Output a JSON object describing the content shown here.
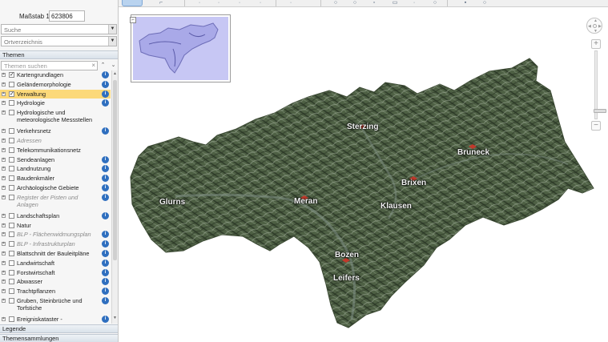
{
  "scale": {
    "label": "Maßstab 1:",
    "value": "623806"
  },
  "search": {
    "placeholder": "Suche"
  },
  "placeindex": {
    "placeholder": "Ortverzeichnis"
  },
  "themes": {
    "header": "Themen",
    "filter_placeholder": "Themen suchen",
    "items": [
      {
        "label": "Kartengrundlagen",
        "checked": true,
        "info": true
      },
      {
        "label": "Geländemorphologie",
        "checked": false,
        "info": true
      },
      {
        "label": "Verwaltung",
        "checked": true,
        "info": true,
        "selected": true
      },
      {
        "label": "Hydrologie",
        "checked": false,
        "info": true
      },
      {
        "label": "Hydrologische und meteorologische Messstellen",
        "checked": false,
        "info": false
      },
      {
        "label": "Verkehrsnetz",
        "checked": false,
        "info": true
      },
      {
        "label": "Adressen",
        "checked": false,
        "info": false,
        "disabled": true
      },
      {
        "label": "Telekommunikationsnetz",
        "checked": false,
        "info": false
      },
      {
        "label": "Sendeanlagen",
        "checked": false,
        "info": true
      },
      {
        "label": "Landnutzung",
        "checked": false,
        "info": true
      },
      {
        "label": "Baudenkmäler",
        "checked": false,
        "info": true
      },
      {
        "label": "Archäologische Gebiete",
        "checked": false,
        "info": true
      },
      {
        "label": "Register der Pisten und Anlagen",
        "checked": false,
        "info": true,
        "disabled": true
      },
      {
        "label": "Landschaftsplan",
        "checked": false,
        "info": true
      },
      {
        "label": "Natur",
        "checked": false,
        "info": false
      },
      {
        "label": "BLP - Flächenwidmungsplan",
        "checked": false,
        "info": true,
        "disabled": true
      },
      {
        "label": "BLP - Infrastrukturplan",
        "checked": false,
        "info": true,
        "disabled": true
      },
      {
        "label": "Blattschnitt der Bauleitpläne",
        "checked": false,
        "info": true
      },
      {
        "label": "Landwirtschaft",
        "checked": false,
        "info": true
      },
      {
        "label": "Forstwirtschaft",
        "checked": false,
        "info": true
      },
      {
        "label": "Abwasser",
        "checked": false,
        "info": true
      },
      {
        "label": "Trachtpflanzen",
        "checked": false,
        "info": true
      },
      {
        "label": "Gruben, Steinbrüche und Torfstiche",
        "checked": false,
        "info": true
      },
      {
        "label": "Ereigniskataster - Naturgefahrenkataster",
        "checked": false,
        "info": true
      }
    ]
  },
  "legend_header": "Legende",
  "collections_header": "Themensammlungen",
  "map": {
    "cities": [
      {
        "name": "Sterzing"
      },
      {
        "name": "Bruneck"
      },
      {
        "name": "Brixen"
      },
      {
        "name": "Glurns"
      },
      {
        "name": "Meran"
      },
      {
        "name": "Klausen"
      },
      {
        "name": "Bozen"
      },
      {
        "name": "Leifers"
      }
    ]
  },
  "icons": {
    "expand": "plus-box-icon",
    "info": "info-icon",
    "clear": "clear-x-icon",
    "dropdown": "chevron-down-icon"
  },
  "colors": {
    "selected_row": "#fcd97a",
    "info_badge": "#2f6fbf",
    "overview_fill": "#c7c7f4",
    "panel_header": "#d9e1ea"
  }
}
